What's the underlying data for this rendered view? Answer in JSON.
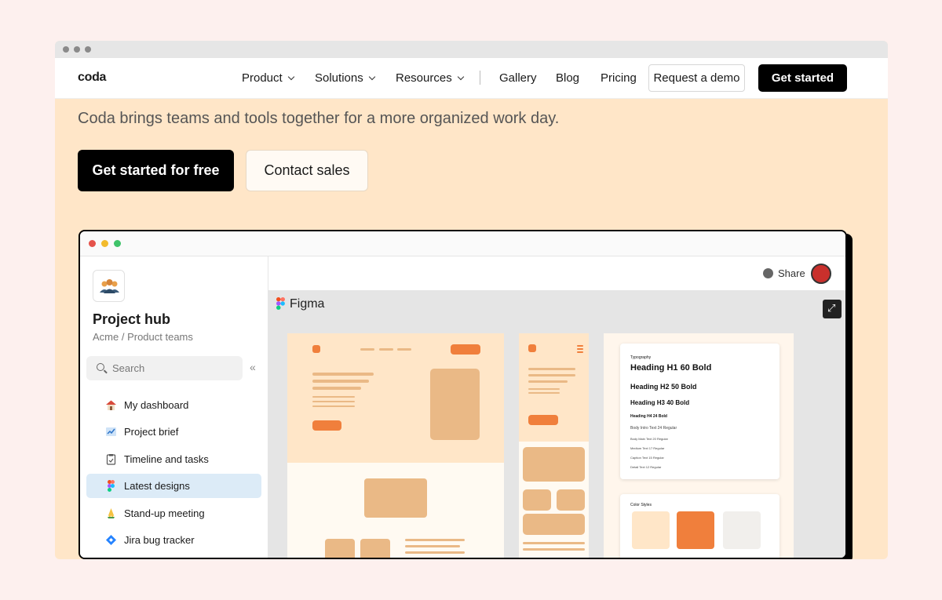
{
  "nav": {
    "logo": "coda",
    "items": [
      "Product",
      "Solutions",
      "Resources"
    ],
    "links": [
      "Gallery",
      "Blog",
      "Pricing"
    ],
    "request_demo": "Request a demo",
    "get_started": "Get started"
  },
  "hero": {
    "tagline": "Coda brings teams and tools together for a more organized work day.",
    "cta_primary": "Get started for free",
    "cta_secondary": "Contact sales"
  },
  "app": {
    "hub_title": "Project hub",
    "hub_subtitle": "Acme / Product teams",
    "search_placeholder": "Search",
    "sidebar_items": [
      {
        "label": "My dashboard",
        "icon": "house-icon"
      },
      {
        "label": "Project brief",
        "icon": "chart-icon"
      },
      {
        "label": "Timeline and tasks",
        "icon": "clipboard-icon"
      },
      {
        "label": "Latest designs",
        "icon": "figma-icon",
        "active": true
      },
      {
        "label": "Stand-up meeting",
        "icon": "hands-icon"
      },
      {
        "label": "Jira bug tracker",
        "icon": "jira-icon"
      }
    ],
    "share_label": "Share",
    "canvas_title": "Figma",
    "typography": {
      "heading": "Typography",
      "h1": "Heading H1 60 Bold",
      "h2": "Heading H2 50 Bold",
      "h3": "Heading H3 40 Bold",
      "h4": "Heading H4 24 Bold",
      "body1": "Body Intro Text 24 Regular",
      "body2": "Body Main Text 20 Regular",
      "small": "Medium Text 17 Regular",
      "caption": "Caption Text 15 Regular",
      "detail": "Detail Text 12 Regular"
    },
    "color_styles": "Color Styles",
    "button_text": "Button"
  },
  "colors": {
    "hero_bg": "#ffe6c8",
    "page_bg": "#fdf0ee",
    "accent": "#f07f3c",
    "tan": "#eab986",
    "active_item": "#dcebf7"
  }
}
